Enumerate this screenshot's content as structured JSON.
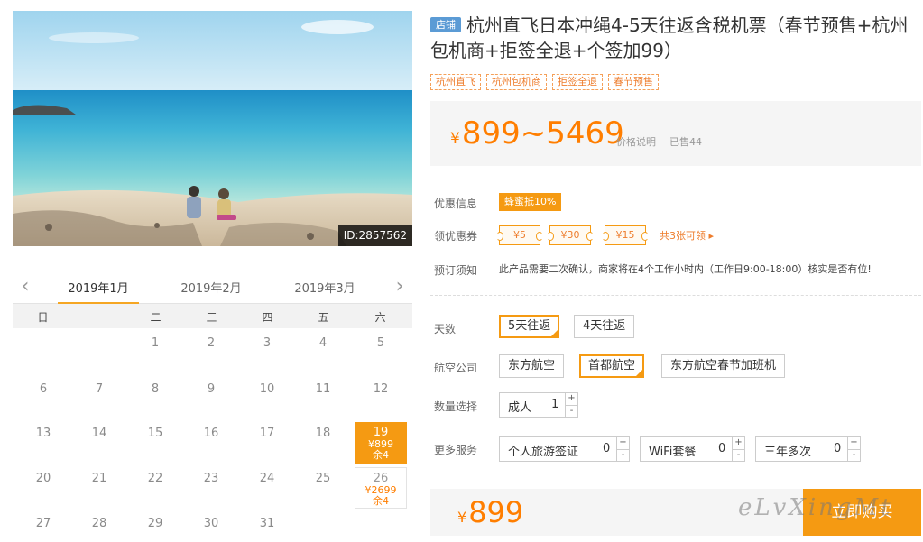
{
  "image": {
    "id_label": "ID:2857562"
  },
  "calendar": {
    "prev_icon": "chevron-left",
    "next_icon": "chevron-right",
    "months": [
      "2019年1月",
      "2019年2月",
      "2019年3月"
    ],
    "active_month": 0,
    "weekdays": [
      "日",
      "一",
      "二",
      "三",
      "四",
      "五",
      "六"
    ],
    "first_weekday": 2,
    "days": [
      {
        "d": "1"
      },
      {
        "d": "2"
      },
      {
        "d": "3"
      },
      {
        "d": "4"
      },
      {
        "d": "5"
      },
      {
        "d": "6"
      },
      {
        "d": "7"
      },
      {
        "d": "8"
      },
      {
        "d": "9"
      },
      {
        "d": "10"
      },
      {
        "d": "11"
      },
      {
        "d": "12"
      },
      {
        "d": "13"
      },
      {
        "d": "14"
      },
      {
        "d": "15"
      },
      {
        "d": "16"
      },
      {
        "d": "17"
      },
      {
        "d": "18"
      },
      {
        "d": "19",
        "price": "¥899",
        "remain": "余4",
        "state": "selected"
      },
      {
        "d": "20"
      },
      {
        "d": "21"
      },
      {
        "d": "22"
      },
      {
        "d": "23"
      },
      {
        "d": "24"
      },
      {
        "d": "25"
      },
      {
        "d": "26",
        "price": "¥2699",
        "remain": "余4",
        "state": "outlined"
      },
      {
        "d": "27"
      },
      {
        "d": "28"
      },
      {
        "d": "29"
      },
      {
        "d": "30"
      },
      {
        "d": "31"
      }
    ]
  },
  "product": {
    "shop_badge": "店铺",
    "title": "杭州直飞日本冲绳4-5天往返含税机票（春节预售+杭州包机商+拒签全退+个签加99）",
    "tags": [
      "杭州直飞",
      "杭州包机商",
      "拒签全退",
      "春节预售"
    ],
    "price_symbol": "¥",
    "price_range": "899~5469",
    "price_desc": "价格说明",
    "sold": "已售44"
  },
  "promo": {
    "label": "优惠信息",
    "badge": "蜂蜜抵10%",
    "coupon_label": "领优惠券",
    "coupons": [
      "¥5",
      "¥30",
      "¥15"
    ],
    "coupon_total": "共3张可领 ▸"
  },
  "booking": {
    "label": "预订须知",
    "notice": "此产品需要二次确认，商家将在4个工作小时内（工作日9:00-18:00）核实是否有位!"
  },
  "options": {
    "days_label": "天数",
    "days": [
      "5天往返",
      "4天往返"
    ],
    "days_selected": 0,
    "airline_label": "航空公司",
    "airlines": [
      "东方航空",
      "首都航空",
      "东方航空春节加班机"
    ],
    "airline_selected": 1,
    "qty_label": "数量选择",
    "qty": {
      "name": "成人",
      "value": "1"
    },
    "extra_label": "更多服务",
    "extras": [
      {
        "name": "个人旅游签证",
        "value": "0"
      },
      {
        "name": "WiFi套餐",
        "value": "0"
      },
      {
        "name": "三年多次",
        "value": "0"
      }
    ],
    "plus": "+",
    "minus": "-"
  },
  "bottom": {
    "price_symbol": "¥",
    "price": "899",
    "buy": "立即购买",
    "watermark": "eLvXingMt"
  },
  "colors": {
    "accent": "#f59a12",
    "price": "#ff7e00",
    "badge_blue": "#5b9bd5"
  }
}
